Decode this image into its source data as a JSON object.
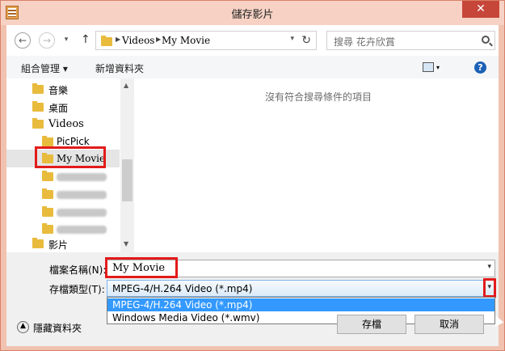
{
  "window": {
    "title": "儲存影片"
  },
  "nav": {
    "breadcrumb": [
      "Videos",
      "My Movie"
    ],
    "search_placeholder": "搜尋 花卉欣賞"
  },
  "toolbar": {
    "organize": "組合管理 ▾",
    "new_folder": "新增資料夾"
  },
  "tree": {
    "items": [
      "音樂",
      "桌面",
      "Videos",
      "PicPick",
      "My Movie",
      "影片"
    ]
  },
  "pane": {
    "empty_message": "沒有符合搜尋條件的項目"
  },
  "form": {
    "filename_label": "檔案名稱(N):",
    "filename_value": "My Movie",
    "filetype_label": "存檔類型(T):",
    "filetype_value": "MPEG-4/H.264  Video   (*.mp4)",
    "filetype_options": [
      "MPEG-4/H.264  Video   (*.mp4)",
      "Windows Media Video   (*.wmv)"
    ]
  },
  "footer": {
    "hide_folders": "隱藏資料夾",
    "save": "存檔",
    "cancel": "取消"
  },
  "colors": {
    "accent": "#3399ff",
    "highlight": "#e21b1b",
    "close": "#c7463a"
  }
}
